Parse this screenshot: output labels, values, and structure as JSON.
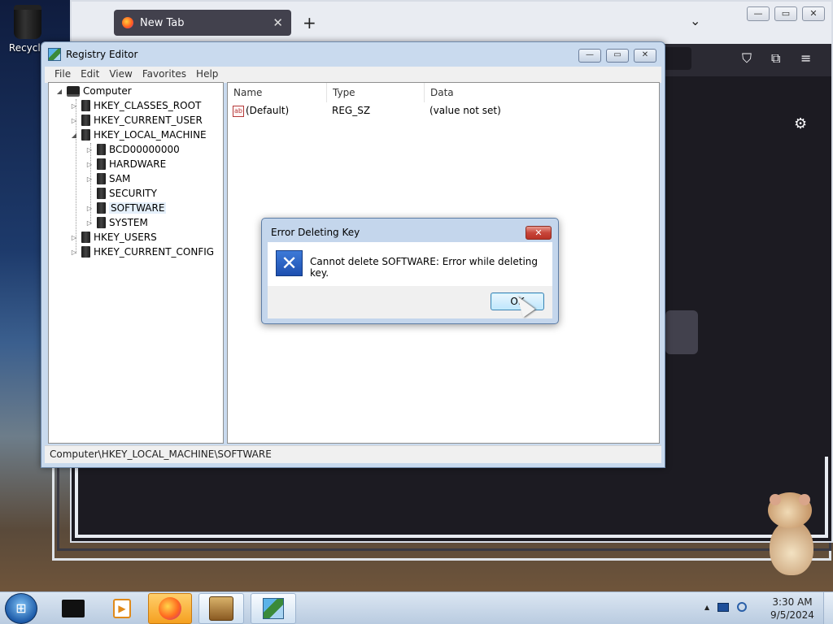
{
  "desktop": {
    "recycle_bin_label": "Recycle"
  },
  "browser": {
    "tab_title": "New Tab",
    "tab_close": "✕",
    "new_tab": "+",
    "list_all_tabs": "⌄",
    "window_controls": [
      "—",
      "▭",
      "✕"
    ],
    "toolbar_icons": [
      "pocket-icon",
      "extensions-icon",
      "menu-icon"
    ],
    "settings_icon": "gear-icon"
  },
  "regedit": {
    "title": "Registry Editor",
    "window_controls": [
      "—",
      "▭",
      "✕"
    ],
    "menu": [
      "File",
      "Edit",
      "View",
      "Favorites",
      "Help"
    ],
    "tree": {
      "root": "Computer",
      "hkcr": "HKEY_CLASSES_ROOT",
      "hkcu": "HKEY_CURRENT_USER",
      "hklm": "HKEY_LOCAL_MACHINE",
      "hklm_children": {
        "bcd": "BCD00000000",
        "hardware": "HARDWARE",
        "sam": "SAM",
        "security": "SECURITY",
        "software": "SOFTWARE",
        "system": "SYSTEM"
      },
      "hku": "HKEY_USERS",
      "hkcc": "HKEY_CURRENT_CONFIG",
      "selected": "SOFTWARE"
    },
    "columns": {
      "name": "Name",
      "type": "Type",
      "data": "Data"
    },
    "rows": [
      {
        "icon": "ab",
        "name": "(Default)",
        "type": "REG_SZ",
        "data": "(value not set)"
      }
    ],
    "status_path": "Computer\\HKEY_LOCAL_MACHINE\\SOFTWARE"
  },
  "dialog": {
    "title": "Error Deleting Key",
    "close": "✕",
    "icon": "error-x-icon",
    "icon_glyph": "✕",
    "message": "Cannot delete SOFTWARE:  Error while deleting key.",
    "ok_label": "OK"
  },
  "taskbar": {
    "start_glyph": "⊞",
    "apps": [
      "terminal-icon",
      "media-player-icon",
      "firefox-icon",
      "hamster-box-icon",
      "registry-editor-icon"
    ],
    "active_app": "firefox-icon",
    "tray_arrow": "▲",
    "clock_time": "3:30 AM",
    "clock_date": "9/5/2024"
  },
  "colors": {
    "selection_bg": "#e5f0fb",
    "dialog_frame": "#c4d6ec",
    "close_red": "#c8463a",
    "taskbar": "#b9cbe0"
  }
}
